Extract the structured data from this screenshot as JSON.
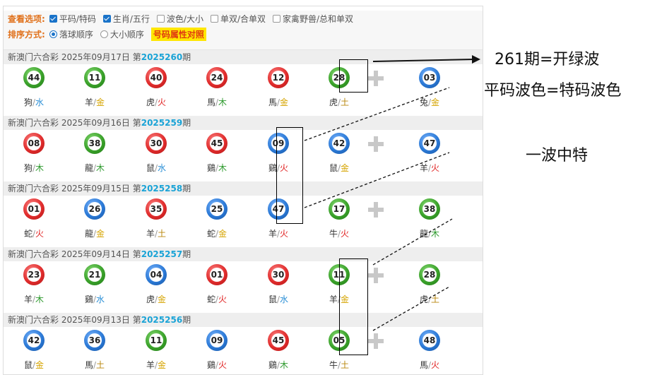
{
  "options": {
    "view_label": "查看选项:",
    "view_items": [
      {
        "label": "平码/特码",
        "checked": true
      },
      {
        "label": "生肖/五行",
        "checked": true
      },
      {
        "label": "波色/大小",
        "checked": false
      },
      {
        "label": "单双/合单双",
        "checked": false
      },
      {
        "label": "家禽野兽/总和单双",
        "checked": false
      }
    ],
    "sort_label": "排序方式:",
    "sort_items": [
      {
        "label": "落球顺序",
        "selected": true
      },
      {
        "label": "大小顺序",
        "selected": false
      }
    ],
    "attr_button": "号码属性对照"
  },
  "colors": {
    "red": "#e02c2c",
    "green": "#3aa12a",
    "blue": "#2b79d6",
    "issue": "#1aa3d6"
  },
  "draws": [
    {
      "prefix": "新澳门六合彩 2025年09月17日 第",
      "issue": "2025260",
      "suffix": "期",
      "balls": [
        {
          "num": "44",
          "color": "green",
          "zodiac": "狗",
          "element": "水"
        },
        {
          "num": "11",
          "color": "green",
          "zodiac": "羊",
          "element": "金"
        },
        {
          "num": "40",
          "color": "red",
          "zodiac": "虎",
          "element": "火"
        },
        {
          "num": "24",
          "color": "red",
          "zodiac": "馬",
          "element": "木"
        },
        {
          "num": "12",
          "color": "red",
          "zodiac": "馬",
          "element": "金"
        },
        {
          "num": "28",
          "color": "green",
          "zodiac": "虎",
          "element": "土"
        },
        {
          "num": "03",
          "color": "blue",
          "zodiac": "兔",
          "element": "金"
        }
      ]
    },
    {
      "prefix": "新澳门六合彩 2025年09月16日 第",
      "issue": "2025259",
      "suffix": "期",
      "balls": [
        {
          "num": "08",
          "color": "red",
          "zodiac": "狗",
          "element": "木"
        },
        {
          "num": "38",
          "color": "green",
          "zodiac": "龍",
          "element": "木"
        },
        {
          "num": "30",
          "color": "red",
          "zodiac": "鼠",
          "element": "水"
        },
        {
          "num": "45",
          "color": "red",
          "zodiac": "鷄",
          "element": "木"
        },
        {
          "num": "09",
          "color": "blue",
          "zodiac": "鷄",
          "element": "火"
        },
        {
          "num": "42",
          "color": "blue",
          "zodiac": "鼠",
          "element": "金"
        },
        {
          "num": "47",
          "color": "blue",
          "zodiac": "羊",
          "element": "火"
        }
      ]
    },
    {
      "prefix": "新澳门六合彩 2025年09月15日 第",
      "issue": "2025258",
      "suffix": "期",
      "balls": [
        {
          "num": "01",
          "color": "red",
          "zodiac": "蛇",
          "element": "火"
        },
        {
          "num": "26",
          "color": "blue",
          "zodiac": "龍",
          "element": "金"
        },
        {
          "num": "35",
          "color": "red",
          "zodiac": "羊",
          "element": "土"
        },
        {
          "num": "25",
          "color": "blue",
          "zodiac": "蛇",
          "element": "金"
        },
        {
          "num": "47",
          "color": "blue",
          "zodiac": "羊",
          "element": "火"
        },
        {
          "num": "17",
          "color": "green",
          "zodiac": "牛",
          "element": "火"
        },
        {
          "num": "38",
          "color": "green",
          "zodiac": "龍",
          "element": "木"
        }
      ]
    },
    {
      "prefix": "新澳门六合彩 2025年09月14日 第",
      "issue": "2025257",
      "suffix": "期",
      "balls": [
        {
          "num": "23",
          "color": "red",
          "zodiac": "羊",
          "element": "木"
        },
        {
          "num": "21",
          "color": "green",
          "zodiac": "鷄",
          "element": "水"
        },
        {
          "num": "04",
          "color": "blue",
          "zodiac": "虎",
          "element": "金"
        },
        {
          "num": "01",
          "color": "red",
          "zodiac": "蛇",
          "element": "火"
        },
        {
          "num": "30",
          "color": "red",
          "zodiac": "鼠",
          "element": "水"
        },
        {
          "num": "11",
          "color": "green",
          "zodiac": "羊",
          "element": "金"
        },
        {
          "num": "28",
          "color": "green",
          "zodiac": "虎",
          "element": "土"
        }
      ]
    },
    {
      "prefix": "新澳门六合彩 2025年09月13日 第",
      "issue": "2025256",
      "suffix": "期",
      "balls": [
        {
          "num": "42",
          "color": "blue",
          "zodiac": "鼠",
          "element": "金"
        },
        {
          "num": "36",
          "color": "blue",
          "zodiac": "馬",
          "element": "土"
        },
        {
          "num": "11",
          "color": "green",
          "zodiac": "羊",
          "element": "金"
        },
        {
          "num": "09",
          "color": "blue",
          "zodiac": "鷄",
          "element": "火"
        },
        {
          "num": "45",
          "color": "red",
          "zodiac": "鷄",
          "element": "木"
        },
        {
          "num": "05",
          "color": "green",
          "zodiac": "牛",
          "element": "土"
        },
        {
          "num": "48",
          "color": "blue",
          "zodiac": "馬",
          "element": "火"
        }
      ]
    }
  ],
  "notes": {
    "note1": "261期=开绿波",
    "note2": "平码波色=特码波色",
    "note3": "一波中特"
  }
}
